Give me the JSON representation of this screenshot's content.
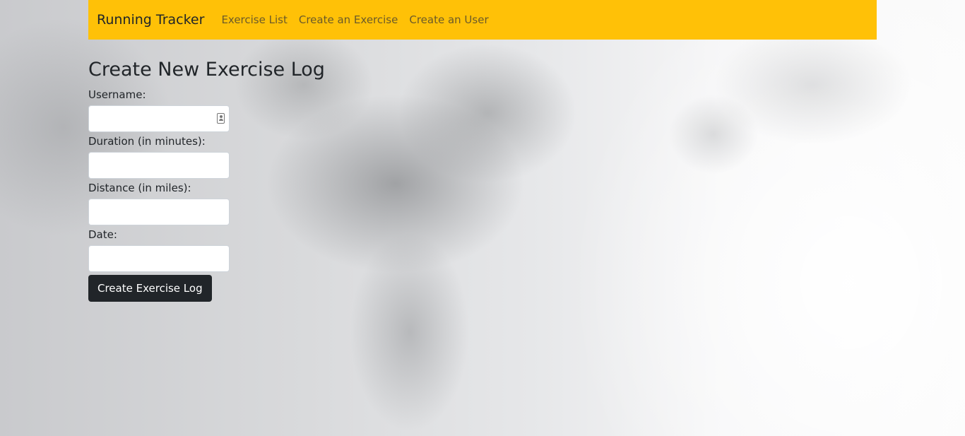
{
  "navbar": {
    "brand": "Running Tracker",
    "links": [
      {
        "label": "Exercise List"
      },
      {
        "label": "Create an Exercise"
      },
      {
        "label": "Create an User"
      }
    ]
  },
  "form": {
    "title": "Create New Exercise Log",
    "fields": [
      {
        "label": "Username:",
        "value": ""
      },
      {
        "label": "Duration (in minutes):",
        "value": ""
      },
      {
        "label": "Distance (in miles):",
        "value": ""
      },
      {
        "label": "Date:",
        "value": ""
      }
    ],
    "submit_label": "Create Exercise Log"
  },
  "colors": {
    "navbar_bg": "#ffc107",
    "button_bg": "#212529"
  },
  "icons": {
    "username_field_icon": "contact-card-icon"
  }
}
